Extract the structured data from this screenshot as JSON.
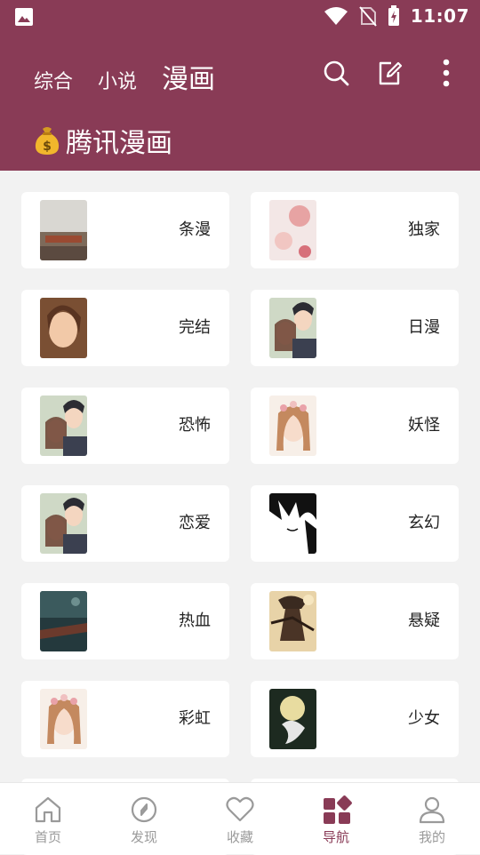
{
  "status_bar": {
    "time": "11:07"
  },
  "header": {
    "tabs": [
      {
        "label": "综合"
      },
      {
        "label": "小说"
      },
      {
        "label": "漫画"
      }
    ],
    "active_tab": 2,
    "source_title": "腾讯漫画",
    "actions": [
      "search-icon",
      "edit-icon",
      "more-vertical-icon"
    ]
  },
  "categories": [
    {
      "label": "条漫"
    },
    {
      "label": "独家"
    },
    {
      "label": "完结"
    },
    {
      "label": "日漫"
    },
    {
      "label": "恐怖"
    },
    {
      "label": "妖怪"
    },
    {
      "label": "恋爱"
    },
    {
      "label": "玄幻"
    },
    {
      "label": "热血"
    },
    {
      "label": "悬疑"
    },
    {
      "label": "彩虹"
    },
    {
      "label": "少女"
    }
  ],
  "bottom_nav": [
    {
      "label": "首页",
      "icon": "home-icon"
    },
    {
      "label": "发现",
      "icon": "compass-icon"
    },
    {
      "label": "收藏",
      "icon": "heart-icon"
    },
    {
      "label": "导航",
      "icon": "grid-icon"
    },
    {
      "label": "我的",
      "icon": "user-icon"
    }
  ],
  "active_nav": 3,
  "colors": {
    "primary": "#893b56",
    "background": "#f2f2f2"
  }
}
